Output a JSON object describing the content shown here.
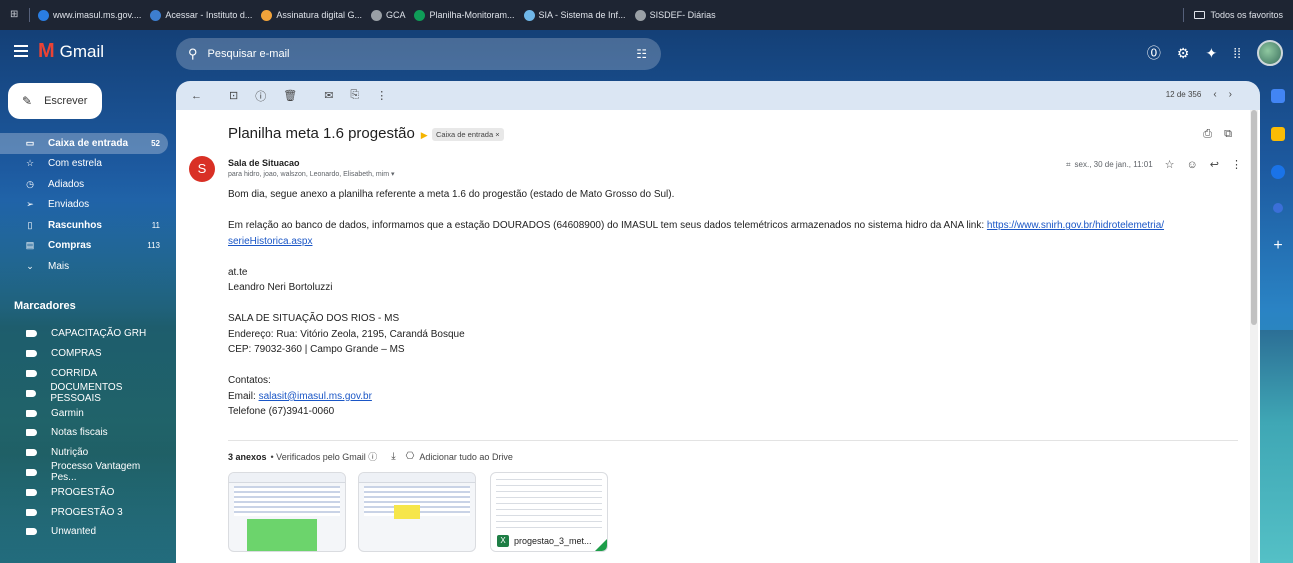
{
  "bookmarks": {
    "items": [
      {
        "label": "www.imasul.ms.gov....",
        "color": "#2a7de1"
      },
      {
        "label": "Acessar - Instituto d...",
        "color": "#3d7ecf"
      },
      {
        "label": "Assinatura digital G...",
        "color": "#f2a33a"
      },
      {
        "label": "GCA",
        "color": "#9aa0a6"
      },
      {
        "label": "Planilha-Monitoram...",
        "color": "#0f9d58"
      },
      {
        "label": "SIA - Sistema de Inf...",
        "color": "#6fb7e9"
      },
      {
        "label": "SISDEF- Diárias",
        "color": "#9aa0a6"
      }
    ],
    "all_favorites": "Todos os favoritos"
  },
  "header": {
    "app_name": "Gmail",
    "search_placeholder": "Pesquisar e-mail"
  },
  "sidebar": {
    "compose_label": "Escrever",
    "items": [
      {
        "label": "Caixa de entrada",
        "count": "52",
        "icon": "inbox-icon",
        "glyph": "▭"
      },
      {
        "label": "Com estrela",
        "count": "",
        "icon": "star-icon",
        "glyph": "☆"
      },
      {
        "label": "Adiados",
        "count": "",
        "icon": "clock-icon",
        "glyph": "◷"
      },
      {
        "label": "Enviados",
        "count": "",
        "icon": "send-icon",
        "glyph": "➢"
      },
      {
        "label": "Rascunhos",
        "count": "11",
        "icon": "draft-icon",
        "glyph": "▯"
      },
      {
        "label": "Compras",
        "count": "113",
        "icon": "cart-icon",
        "glyph": "▤"
      },
      {
        "label": "Mais",
        "count": "",
        "icon": "chevron-down-icon",
        "glyph": "⌄"
      }
    ],
    "labels_title": "Marcadores",
    "labels": [
      "CAPACITAÇÃO GRH",
      "COMPRAS",
      "CORRIDA",
      "DOCUMENTOS PESSOAIS",
      "Garmin",
      "Notas fiscais",
      "Nutrição",
      "Processo Vantagem Pes...",
      "PROGESTÃO",
      "PROGESTÃO 3",
      "Unwanted"
    ]
  },
  "toolbar": {
    "pager": "12 de 356"
  },
  "email": {
    "subject": "Planilha meta 1.6 progestão",
    "inbox_chip": "Caixa de entrada ×",
    "sender": "Sala de Situacao",
    "sender_initial": "S",
    "recipients": "para hidro, joao, walszon, Leonardo, Elisabeth, mim ▾",
    "date": "sex., 30 de jan., 11:01",
    "body": {
      "l1": "Bom dia, segue anexo a planilha referente a meta 1.6 do progestão (estado de Mato Grosso do Sul).",
      "l2": "Em relação ao banco de dados, informamos que a estação DOURADOS (64608900) do IMASUL tem seus dados telemétricos armazenados no sistema hidro da ANA link: ",
      "link1a": "https://www.snirh.gov.br/hidrotelemetria/",
      "link1b": "serieHistorica.aspx",
      "l3": "at.te",
      "l4": "Leandro Neri Bortoluzzi",
      "l5": "SALA DE SITUAÇÃO DOS RIOS - MS",
      "l6": "Endereço: Rua: Vitório Zeola, 2195, Carandá Bosque",
      "l7": "CEP: 79032-360 | Campo Grande – MS",
      "l8": "Contatos:",
      "l9": "Email: ",
      "email_link": "salasit@imasul.ms.gov.br",
      "l10": "Telefone (67)3941-0060"
    },
    "attachments": {
      "count_label": "3 anexos",
      "verified": "• Verificados pelo Gmail ⓘ",
      "add_drive": "Adicionar tudo ao Drive",
      "file3": "progestao_3_met..."
    }
  }
}
